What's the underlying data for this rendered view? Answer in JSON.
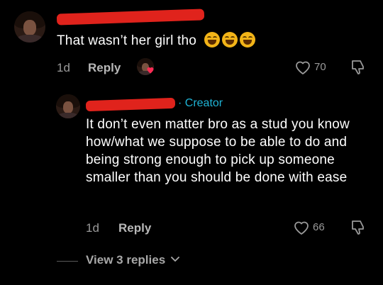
{
  "comment": {
    "text": "That wasn’t her girl tho",
    "emoji": [
      "face-with-tears-of-joy",
      "face-with-tears-of-joy",
      "face-with-tears-of-joy"
    ],
    "time": "1d",
    "reply_label": "Reply",
    "like_count": "70"
  },
  "reply": {
    "creator_badge": "· Creator",
    "text": "It don’t even matter bro as a stud you know how/what we suppose to be able to do and being strong enough to pick up someone smaller than you should be done with ease",
    "time": "1d",
    "reply_label": "Reply",
    "like_count": "66"
  },
  "view_replies_label": "View 3 replies",
  "colors": {
    "background": "#000000",
    "creator_accent": "#1fb4d6",
    "redaction": "#e0231c",
    "heart_badge": "#fe2c55"
  }
}
